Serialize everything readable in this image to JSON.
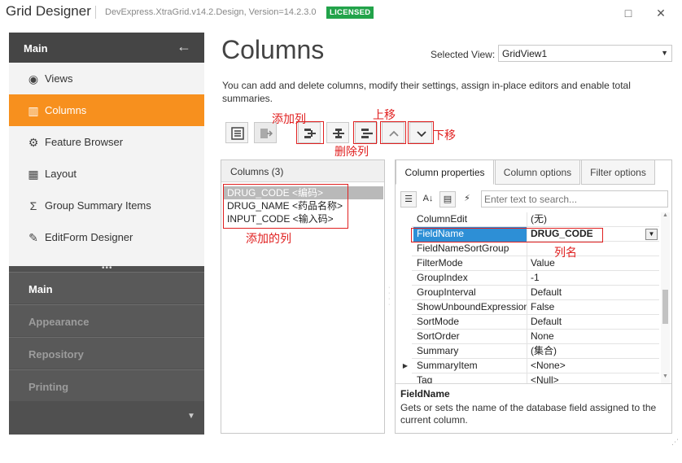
{
  "window": {
    "title": "Grid Designer",
    "version": "DevExpress.XtraGrid.v14.2.Design, Version=14.2.3.0",
    "badge": "LICENSED",
    "badge_color": "#22a34a",
    "maximize_icon": "□",
    "close_icon": "✕"
  },
  "sidebar": {
    "header": "Main",
    "back_icon": "←",
    "accent": "#f7901e",
    "items": [
      {
        "label": "Views",
        "icon": "◉",
        "active": false
      },
      {
        "label": "Columns",
        "icon": "▥",
        "active": true
      },
      {
        "label": "Feature Browser",
        "icon": "⚙",
        "active": false
      },
      {
        "label": "Layout",
        "icon": "▦",
        "active": false
      },
      {
        "label": "Group Summary Items",
        "icon": "Σ",
        "active": false
      },
      {
        "label": "EditForm Designer",
        "icon": "✎",
        "active": false
      }
    ],
    "grip": "•••",
    "groups": [
      "Main",
      "Appearance",
      "Repository",
      "Printing"
    ],
    "more_icon": "▼"
  },
  "main": {
    "title": "Columns",
    "selected_view_label": "Selected View:",
    "selected_view": "GridView1",
    "description": "You can add and delete columns, modify their settings, assign in-place editors and enable total summaries."
  },
  "annotations": {
    "add_column": "添加列",
    "move_up": "上移",
    "delete_column": "删除列",
    "move_down": "下移",
    "added_columns": "添加的列",
    "column_name": "列名"
  },
  "columns_panel": {
    "header": "Columns (3)",
    "items": [
      "DRUG_CODE <编码>",
      "DRUG_NAME <药品名称>",
      "INPUT_CODE <输入码>"
    ],
    "selected_index": 0
  },
  "properties": {
    "tabs": [
      "Column properties",
      "Column options",
      "Filter options"
    ],
    "active_tab": 0,
    "search_placeholder": "Enter text to search...",
    "rows": [
      {
        "name": "ColumnEdit",
        "value": "(无)",
        "expand": ""
      },
      {
        "name": "FieldName",
        "value": "DRUG_CODE",
        "expand": "",
        "selected": true
      },
      {
        "name": "FieldNameSortGroup",
        "value": "",
        "expand": ""
      },
      {
        "name": "FilterMode",
        "value": "Value",
        "expand": ""
      },
      {
        "name": "GroupIndex",
        "value": "-1",
        "expand": ""
      },
      {
        "name": "GroupInterval",
        "value": "Default",
        "expand": ""
      },
      {
        "name": "ShowUnboundExpressionMenu",
        "value": "False",
        "expand": ""
      },
      {
        "name": "SortMode",
        "value": "Default",
        "expand": ""
      },
      {
        "name": "SortOrder",
        "value": "None",
        "expand": ""
      },
      {
        "name": "Summary",
        "value": "(集合)",
        "expand": ""
      },
      {
        "name": "SummaryItem",
        "value": "<None>",
        "expand": "▶"
      },
      {
        "name": "Tag",
        "value": "<Null>",
        "expand": ""
      }
    ],
    "help_title": "FieldName",
    "help_text": "Gets or sets the name of the database field assigned to the current column."
  }
}
